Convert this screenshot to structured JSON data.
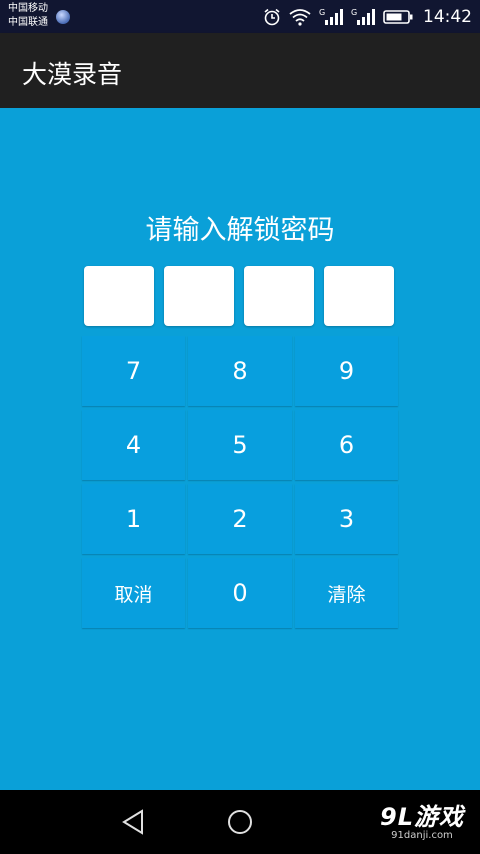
{
  "status_bar": {
    "carrier_1": "中国移动",
    "carrier_2": "中国联通",
    "time": "14:42",
    "icons": [
      "globe-icon",
      "alarm-icon",
      "wifi-icon",
      "signal-icon",
      "signal-icon",
      "battery-icon"
    ],
    "network_label_1": "G",
    "network_label_2": "G"
  },
  "app_bar": {
    "title": "大漠录音"
  },
  "lock": {
    "prompt": "请输入解锁密码",
    "pin_length": 4
  },
  "keypad": {
    "keys": [
      "7",
      "8",
      "9",
      "4",
      "5",
      "6",
      "1",
      "2",
      "3",
      "取消",
      "0",
      "清除"
    ]
  },
  "nav_bar": {
    "icons": [
      "back-icon",
      "home-icon"
    ],
    "watermark_main": "9L游戏",
    "watermark_sub": "91danji.com"
  },
  "colors": {
    "content_bg": "#0aa0d8",
    "key_bg": "#089fde",
    "app_bar_bg": "#202020",
    "status_bar_bg": "#111631"
  }
}
